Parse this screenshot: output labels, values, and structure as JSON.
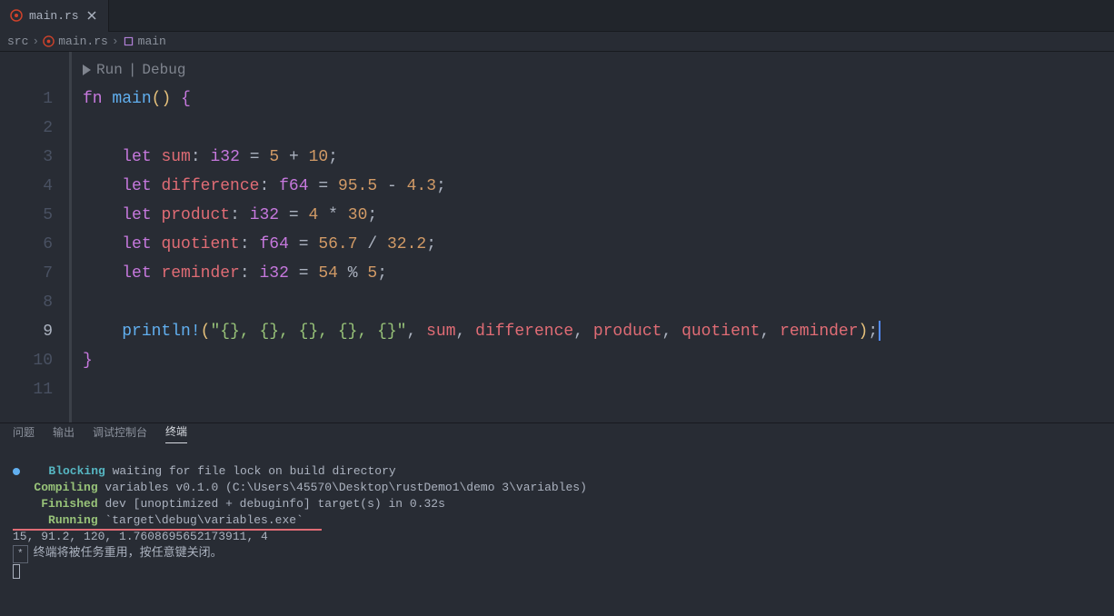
{
  "tab": {
    "name": "main.rs"
  },
  "breadcrumb": {
    "parts": [
      "src",
      "main.rs",
      "main"
    ]
  },
  "codelens": {
    "run": "Run",
    "debug": "Debug"
  },
  "code": {
    "l1": {
      "fn": "fn",
      "main": "main"
    },
    "l3": {
      "let": "let",
      "var": "sum",
      "type": "i32",
      "expr_a": "5",
      "op": "+",
      "expr_b": "10"
    },
    "l4": {
      "let": "let",
      "var": "difference",
      "type": "f64",
      "expr_a": "95.5",
      "op": "-",
      "expr_b": "4.3"
    },
    "l5": {
      "let": "let",
      "var": "product",
      "type": "i32",
      "expr_a": "4",
      "op": "*",
      "expr_b": "30"
    },
    "l6": {
      "let": "let",
      "var": "quotient",
      "type": "f64",
      "expr_a": "56.7",
      "op": "/",
      "expr_b": "32.2"
    },
    "l7": {
      "let": "let",
      "var": "reminder",
      "type": "i32",
      "expr_a": "54",
      "op": "%",
      "expr_b": "5"
    },
    "l9": {
      "macro": "println!",
      "fmt": "\"{}, {}, {}, {}, {}\"",
      "args": [
        "sum",
        "difference",
        "product",
        "quotient",
        "reminder"
      ]
    }
  },
  "linenumbers": [
    "1",
    "2",
    "3",
    "4",
    "5",
    "6",
    "7",
    "8",
    "9",
    "10",
    "11"
  ],
  "panel": {
    "tabs": {
      "problems": "问题",
      "output": "输出",
      "debug": "调试控制台",
      "terminal": "终端"
    }
  },
  "terminal": {
    "blocking_label": "Blocking",
    "blocking_text": " waiting for file lock on build directory",
    "compiling_label": "Compiling",
    "compiling_text": " variables v0.1.0 (C:\\Users\\45570\\Desktop\\rustDemo1\\demo 3\\variables)",
    "finished_label": "Finished",
    "finished_text": " dev [unoptimized + debuginfo] target(s) in 0.32s",
    "running_label": "Running",
    "running_text": " `target\\debug\\variables.exe`",
    "output": "15, 91.2, 120, 1.7608695652173911, 4",
    "reuse_msg": "终端将被任务重用，按任意键关闭。"
  }
}
